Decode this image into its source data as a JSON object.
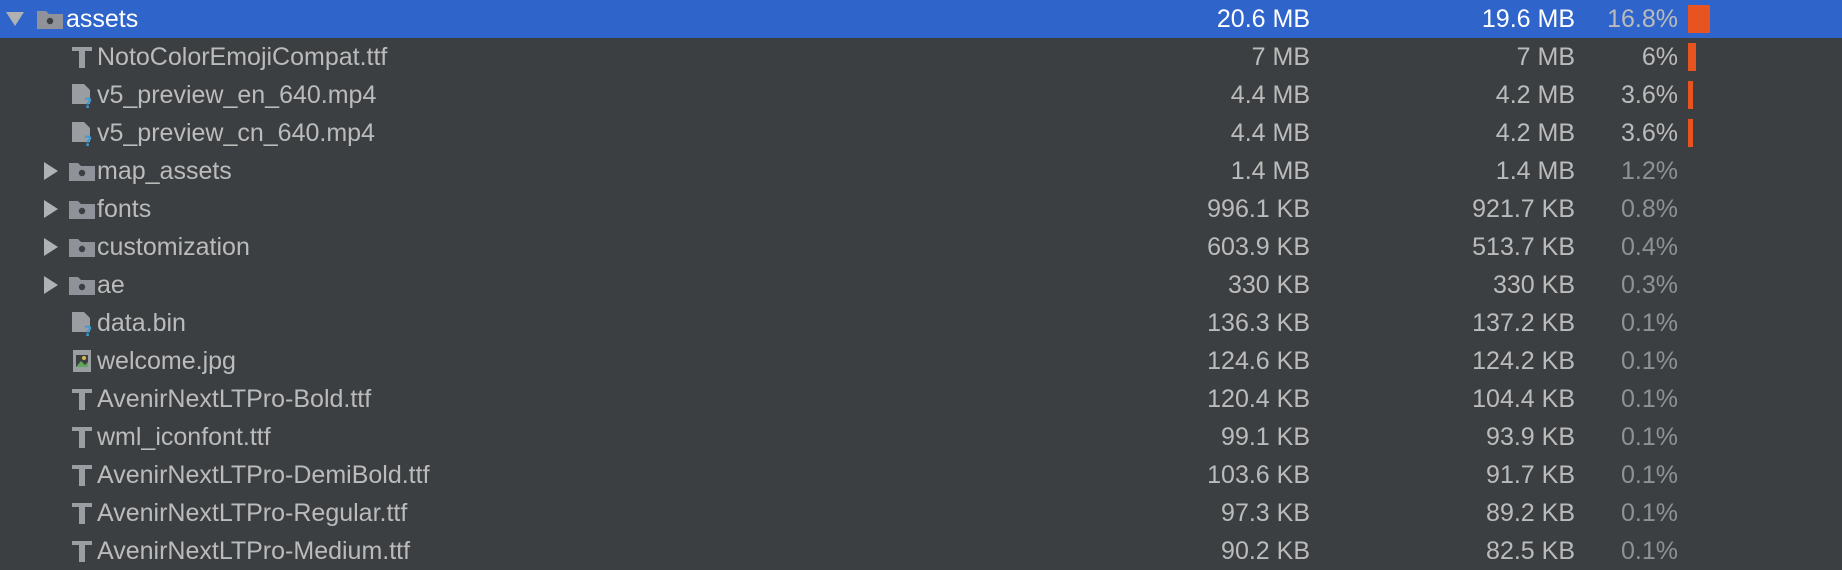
{
  "colors": {
    "background": "#3c3f41",
    "selection": "#2f65ca",
    "bar": "#e8541f",
    "text": "#bbbbbb",
    "dim_text": "#8f9194"
  },
  "rows": [
    {
      "name": "assets",
      "raw": "20.6 MB",
      "download": "19.6 MB",
      "percent": "16.8%",
      "percent_value": 16.8,
      "icon": "folder-icon",
      "expander": "expanded",
      "selected": true
    },
    {
      "name": "NotoColorEmojiCompat.ttf",
      "raw": "7 MB",
      "download": "7 MB",
      "percent": "6%",
      "percent_value": 6,
      "icon": "font-file-icon",
      "expander": "none"
    },
    {
      "name": "v5_preview_en_640.mp4",
      "raw": "4.4 MB",
      "download": "4.2 MB",
      "percent": "3.6%",
      "percent_value": 3.6,
      "icon": "unknown-file-icon",
      "expander": "none"
    },
    {
      "name": "v5_preview_cn_640.mp4",
      "raw": "4.4 MB",
      "download": "4.2 MB",
      "percent": "3.6%",
      "percent_value": 3.6,
      "icon": "unknown-file-icon",
      "expander": "none"
    },
    {
      "name": "map_assets",
      "raw": "1.4 MB",
      "download": "1.4 MB",
      "percent": "1.2%",
      "icon": "folder-icon",
      "expander": "collapsed"
    },
    {
      "name": "fonts",
      "raw": "996.1 KB",
      "download": "921.7 KB",
      "percent": "0.8%",
      "icon": "folder-icon",
      "expander": "collapsed"
    },
    {
      "name": "customization",
      "raw": "603.9 KB",
      "download": "513.7 KB",
      "percent": "0.4%",
      "icon": "folder-icon",
      "expander": "collapsed"
    },
    {
      "name": "ae",
      "raw": "330 KB",
      "download": "330 KB",
      "percent": "0.3%",
      "icon": "folder-icon",
      "expander": "collapsed"
    },
    {
      "name": "data.bin",
      "raw": "136.3 KB",
      "download": "137.2 KB",
      "percent": "0.1%",
      "icon": "unknown-file-icon",
      "expander": "none"
    },
    {
      "name": "welcome.jpg",
      "raw": "124.6 KB",
      "download": "124.2 KB",
      "percent": "0.1%",
      "icon": "image-file-icon",
      "expander": "none"
    },
    {
      "name": "AvenirNextLTPro-Bold.ttf",
      "raw": "120.4 KB",
      "download": "104.4 KB",
      "percent": "0.1%",
      "icon": "font-file-icon",
      "expander": "none"
    },
    {
      "name": "wml_iconfont.ttf",
      "raw": "99.1 KB",
      "download": "93.9 KB",
      "percent": "0.1%",
      "icon": "font-file-icon",
      "expander": "none"
    },
    {
      "name": "AvenirNextLTPro-DemiBold.ttf",
      "raw": "103.6 KB",
      "download": "91.7 KB",
      "percent": "0.1%",
      "icon": "font-file-icon",
      "expander": "none"
    },
    {
      "name": "AvenirNextLTPro-Regular.ttf",
      "raw": "97.3 KB",
      "download": "89.2 KB",
      "percent": "0.1%",
      "icon": "font-file-icon",
      "expander": "none"
    },
    {
      "name": "AvenirNextLTPro-Medium.ttf",
      "raw": "90.2 KB",
      "download": "82.5 KB",
      "percent": "0.1%",
      "icon": "font-file-icon",
      "expander": "none"
    }
  ]
}
